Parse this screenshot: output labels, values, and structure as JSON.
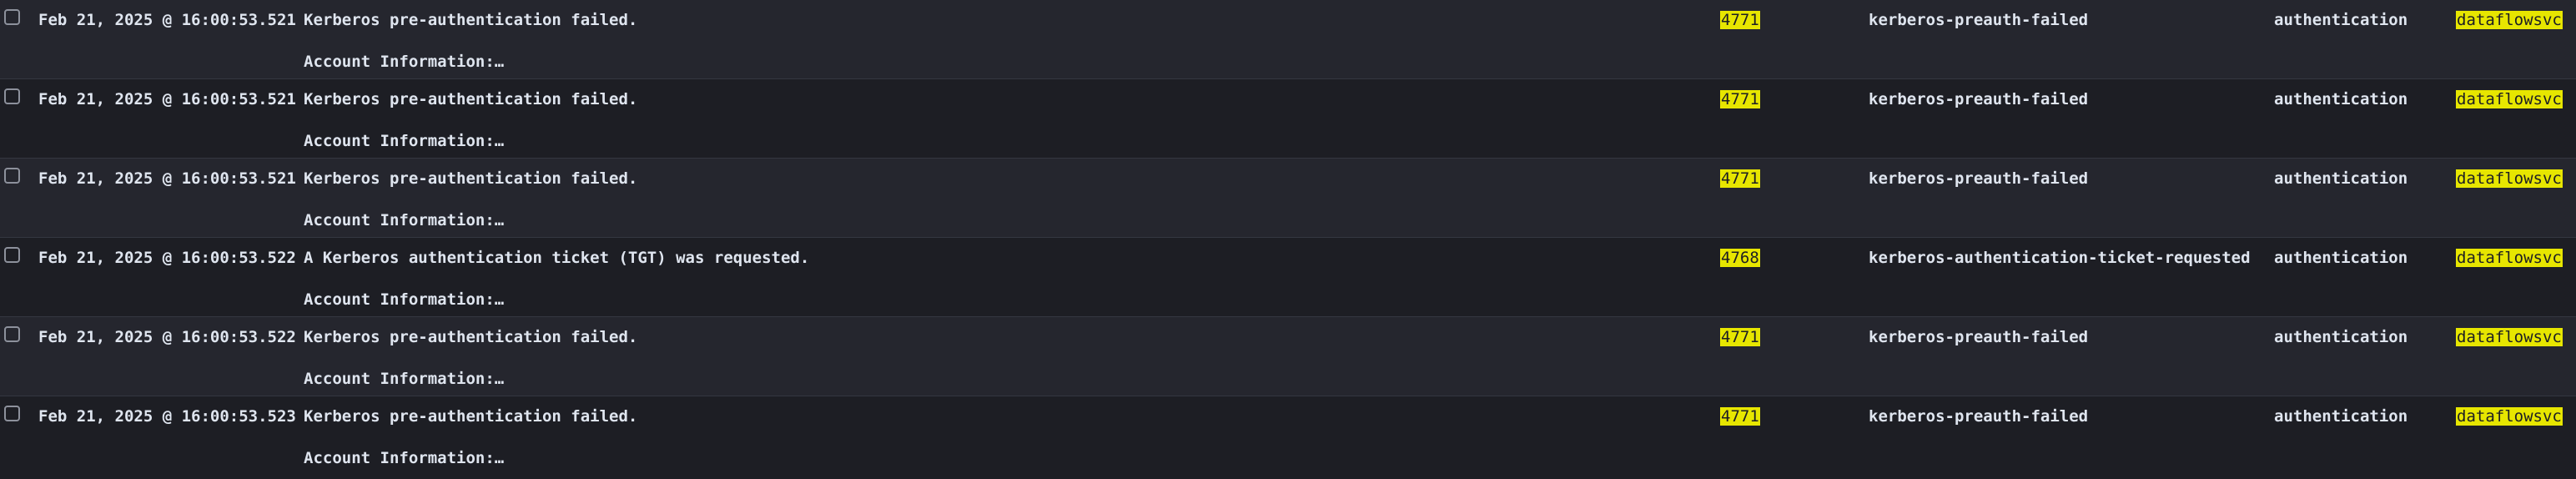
{
  "colors": {
    "background_dark": "#1d1e24",
    "background_light": "#25262e",
    "text": "#dfe5ef",
    "highlight": "#e7e600",
    "divider": "#343741"
  },
  "rows": [
    {
      "timestamp": "Feb 21, 2025 @ 16:00:53.521",
      "message": "Kerberos pre-authentication failed.",
      "message_detail": "Account Information:…",
      "event_code": "4771",
      "event_action": "kerberos-preauth-failed",
      "event_category": "authentication",
      "user": "dataflowsvc"
    },
    {
      "timestamp": "Feb 21, 2025 @ 16:00:53.521",
      "message": "Kerberos pre-authentication failed.",
      "message_detail": "Account Information:…",
      "event_code": "4771",
      "event_action": "kerberos-preauth-failed",
      "event_category": "authentication",
      "user": "dataflowsvc"
    },
    {
      "timestamp": "Feb 21, 2025 @ 16:00:53.521",
      "message": "Kerberos pre-authentication failed.",
      "message_detail": "Account Information:…",
      "event_code": "4771",
      "event_action": "kerberos-preauth-failed",
      "event_category": "authentication",
      "user": "dataflowsvc"
    },
    {
      "timestamp": "Feb 21, 2025 @ 16:00:53.522",
      "message": "A Kerberos authentication ticket (TGT) was requested.",
      "message_detail": "Account Information:…",
      "event_code": "4768",
      "event_action": "kerberos-authentication-ticket-requested",
      "event_category": "authentication",
      "user": "dataflowsvc"
    },
    {
      "timestamp": "Feb 21, 2025 @ 16:00:53.522",
      "message": "Kerberos pre-authentication failed.",
      "message_detail": "Account Information:…",
      "event_code": "4771",
      "event_action": "kerberos-preauth-failed",
      "event_category": "authentication",
      "user": "dataflowsvc"
    },
    {
      "timestamp": "Feb 21, 2025 @ 16:00:53.523",
      "message": "Kerberos pre-authentication failed.",
      "message_detail": "Account Information:…",
      "event_code": "4771",
      "event_action": "kerberos-preauth-failed",
      "event_category": "authentication",
      "user": "dataflowsvc"
    }
  ]
}
